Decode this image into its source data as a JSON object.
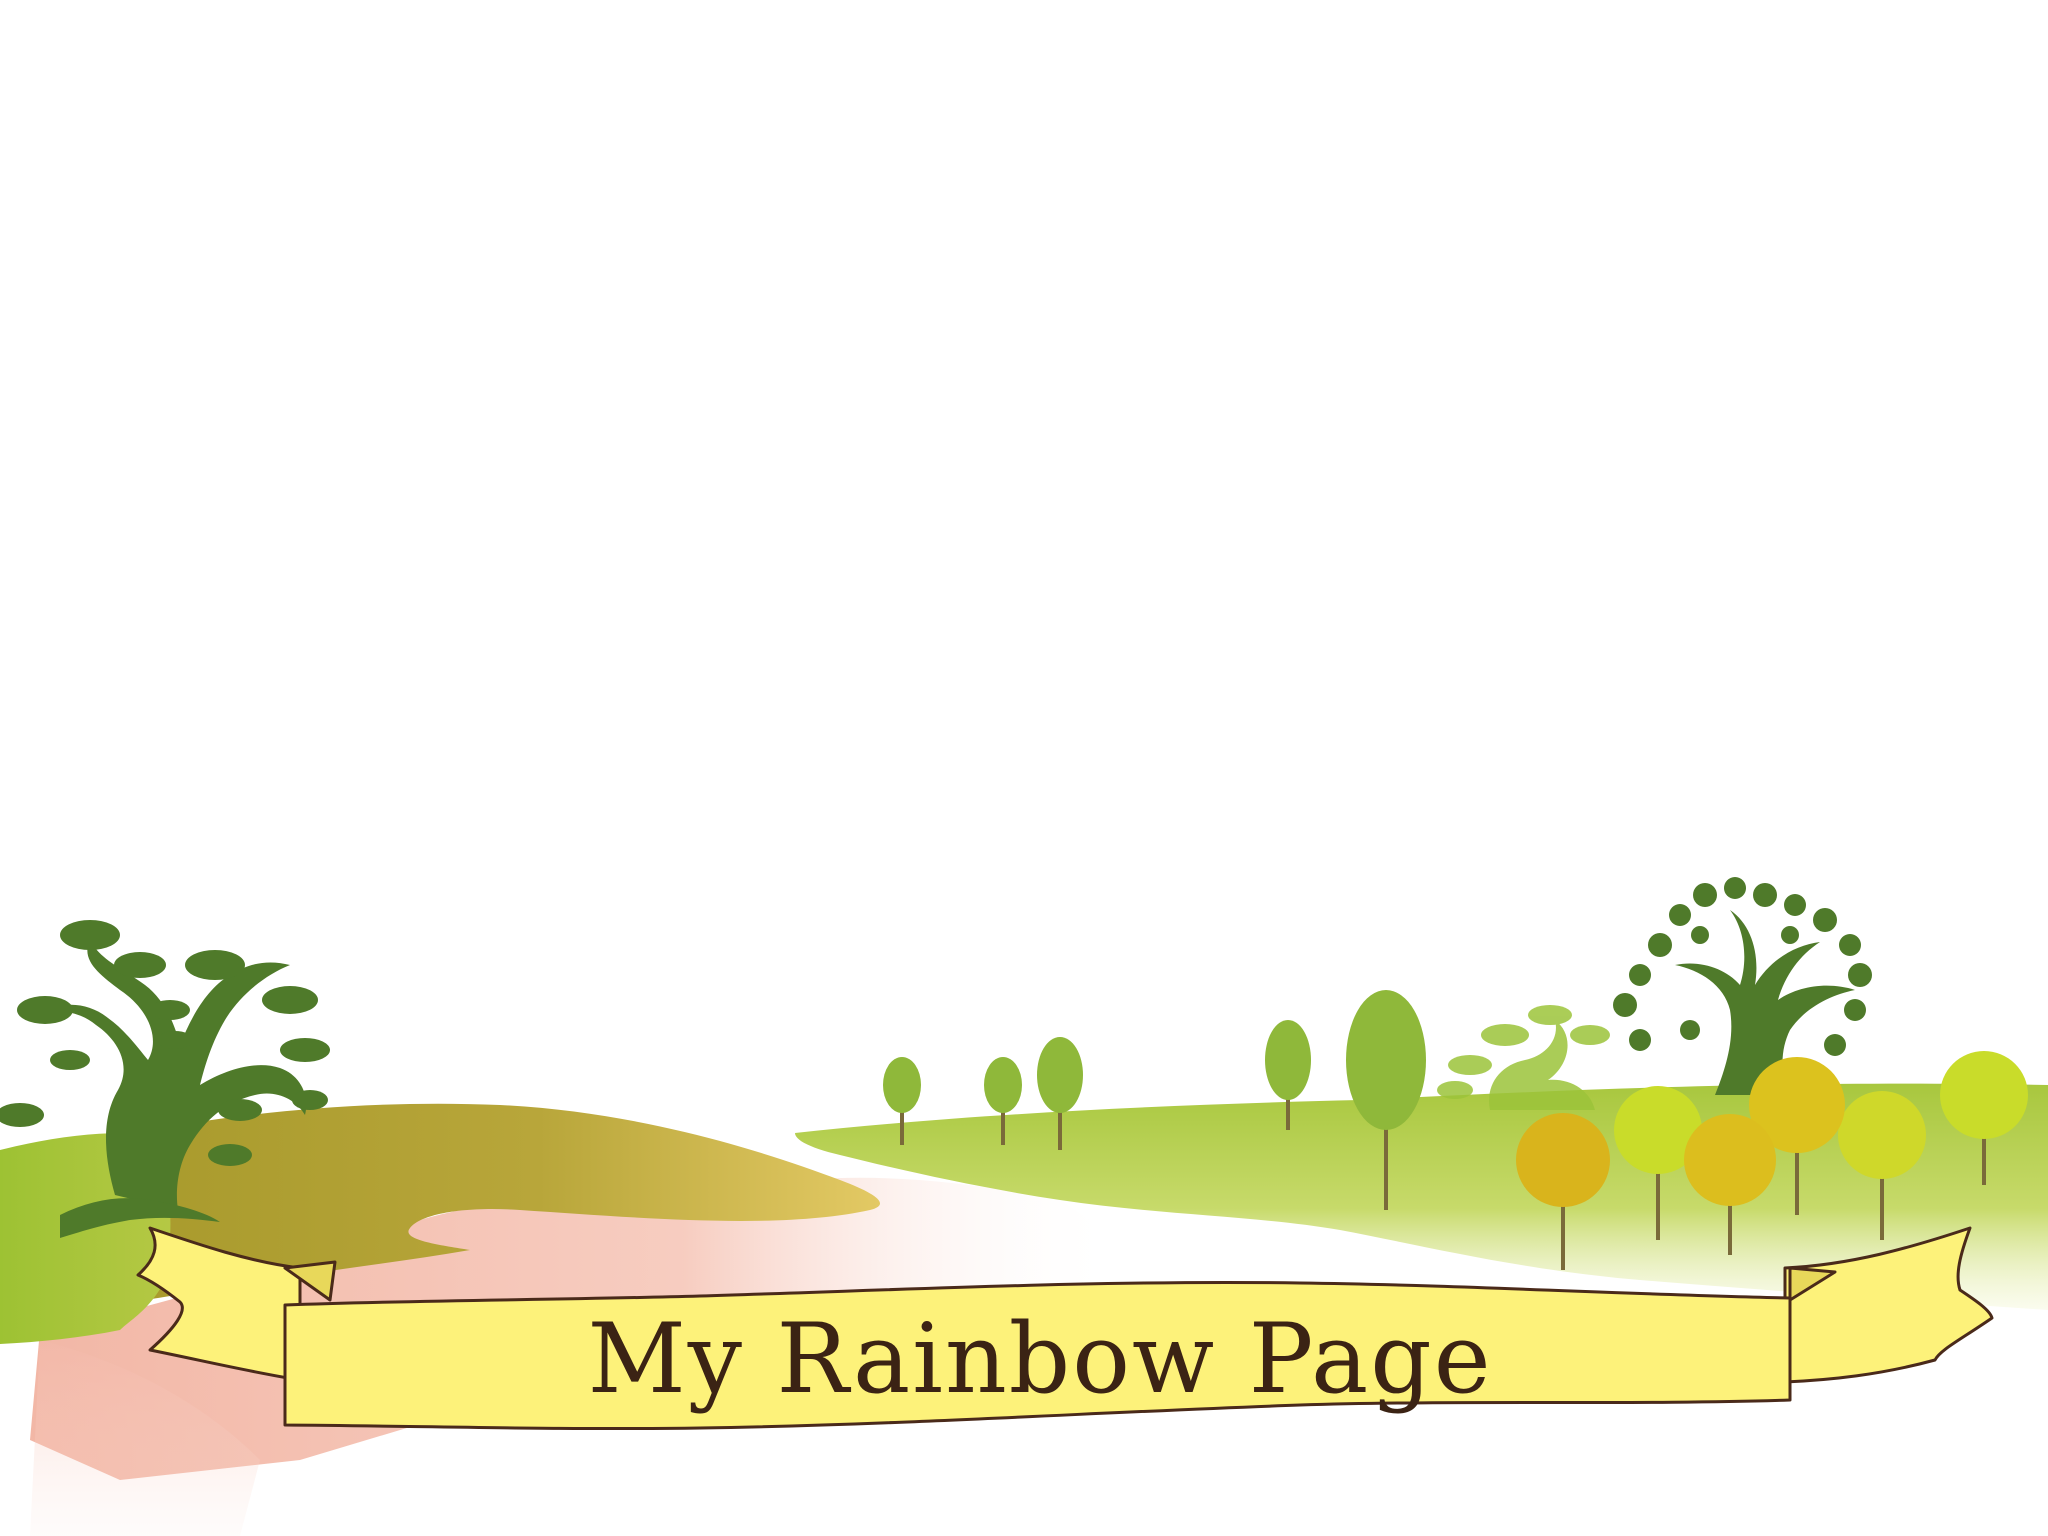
{
  "title": {
    "text": "My Rainbow Page"
  },
  "colors": {
    "background": "#ffffff",
    "banner_fill": "#fdf27a",
    "banner_outline": "#4a2a1a",
    "title_text": "#3b2314",
    "hill_olive": "#b3a532",
    "hill_green": "#a9c83c",
    "path_pink": "#f4b6a8",
    "tree_dark": "#4f7a2a",
    "tree_light": "#8fb83a",
    "tree_yellow": "#dcc21e",
    "tree_lime": "#c9dc2a"
  },
  "icons": {
    "left_tree": "twisted-bonsai-tree-icon",
    "right_tree": "leafy-oak-tree-icon",
    "small_trees": "round-lollipop-tree-icon"
  }
}
